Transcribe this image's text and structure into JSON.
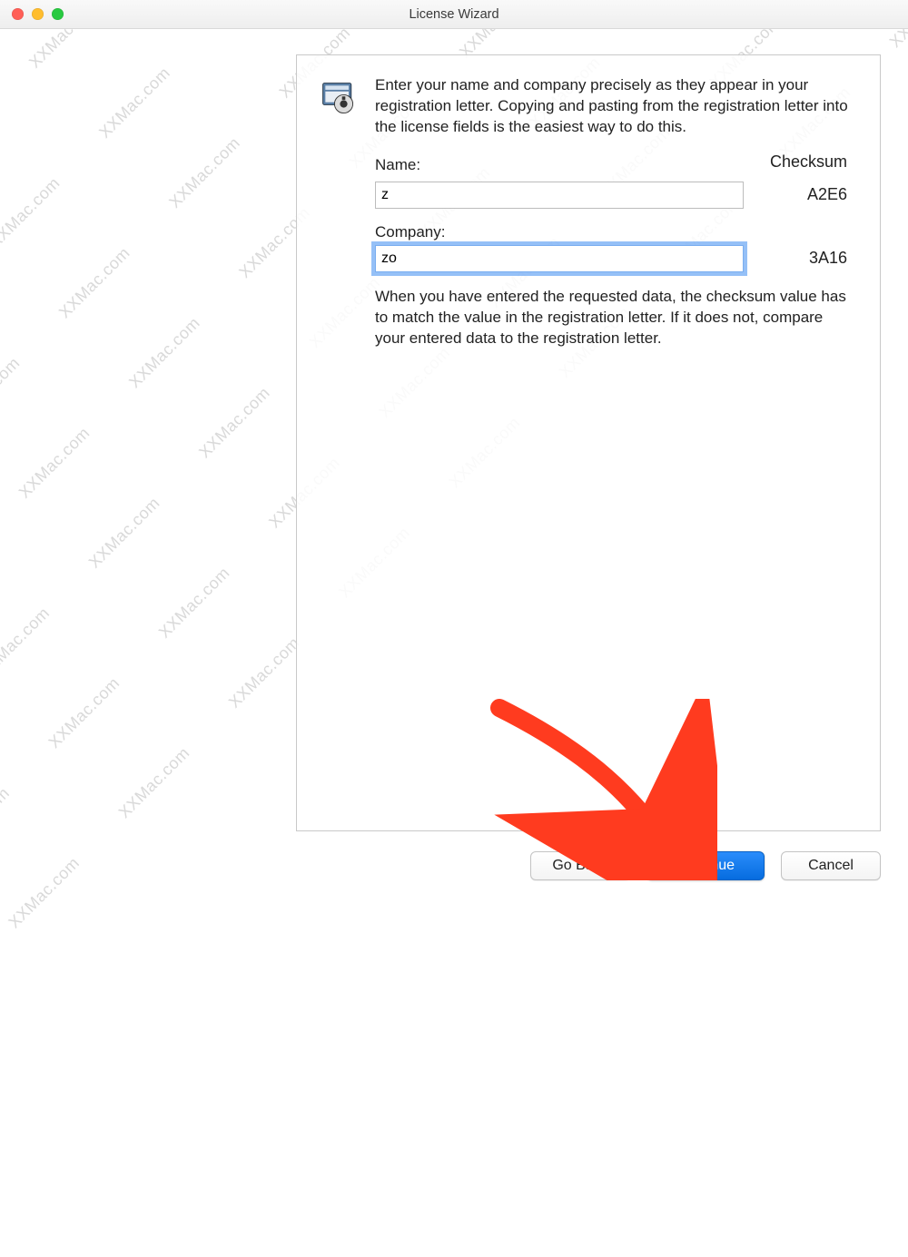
{
  "window": {
    "title": "License Wizard"
  },
  "intro": "Enter your name and company precisely as they appear in your registration letter.  Copying and pasting from the registration letter into the license fields is the easiest way to do this.",
  "labels": {
    "name": "Name:",
    "company": "Company:",
    "checksum": "Checksum"
  },
  "fields": {
    "name_value": "z",
    "company_value": "zo"
  },
  "checksums": {
    "name": "A2E6",
    "company": "3A16"
  },
  "note": "When you have entered the requested data, the checksum value has to match the value in the registration letter.  If it does not, compare your entered data to the registration letter.",
  "buttons": {
    "go_back": "Go Back",
    "continue": "Continue",
    "cancel": "Cancel"
  },
  "watermark_text": "XXMac.com"
}
